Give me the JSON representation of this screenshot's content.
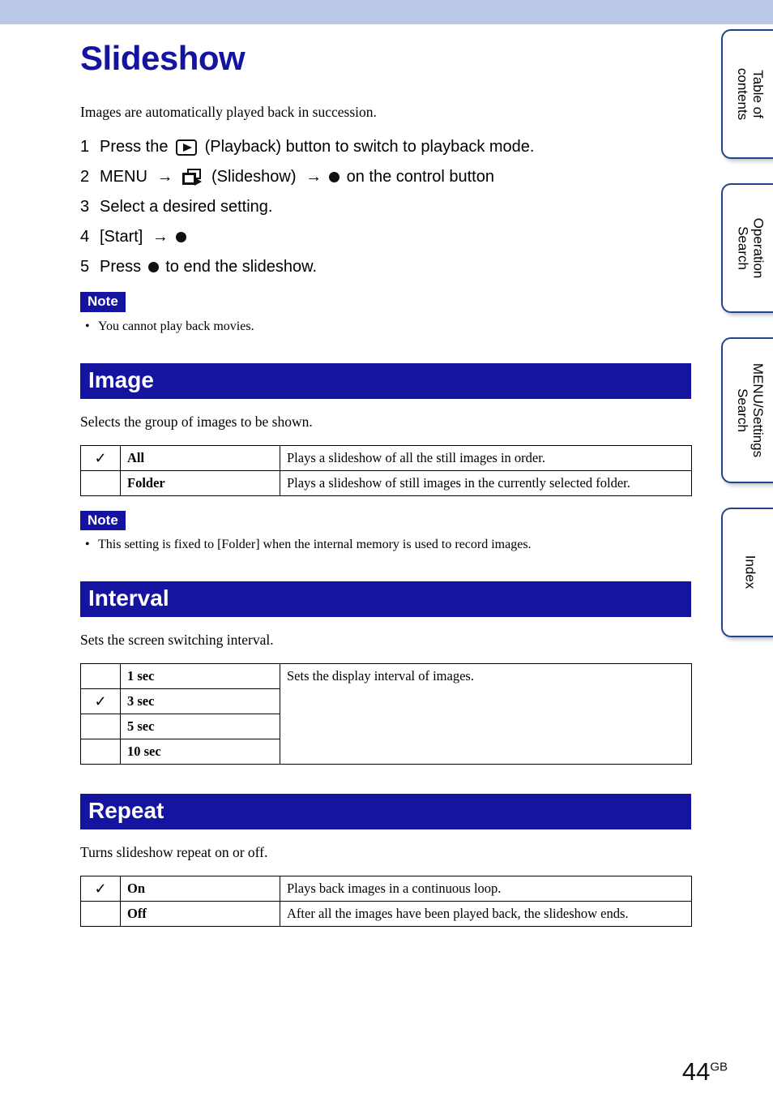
{
  "page": {
    "title": "Slideshow",
    "intro": "Images are automatically played back in succession.",
    "number": "44",
    "number_suffix": "GB",
    "banner_color": "#bcc8ea",
    "accent_color": "#1414a0"
  },
  "side_tabs": [
    {
      "label": "Table of\ncontents",
      "name": "table-of-contents"
    },
    {
      "label": "Operation\nSearch",
      "name": "operation-search"
    },
    {
      "label": "MENU/Settings\nSearch",
      "name": "menu-settings-search"
    },
    {
      "label": "Index",
      "name": "index"
    }
  ],
  "steps": [
    {
      "num": "1",
      "pre": "Press the ",
      "icon": "playback-button-icon",
      "post": " (Playback) button to switch to playback mode."
    },
    {
      "num": "2",
      "pre": "MENU ",
      "arrow1": "→",
      "icon": "slideshow-icon",
      "mid": " (Slideshow) ",
      "arrow2": "→",
      "dot": "control-button-center-dot",
      "post": " on the control button"
    },
    {
      "num": "3",
      "pre": "Select a desired setting."
    },
    {
      "num": "4",
      "pre": "[Start] ",
      "arrow1": "→",
      "dot": "control-button-center-dot"
    },
    {
      "num": "5",
      "pre": "Press ",
      "dot": "control-button-center-dot",
      "post": " to end the slideshow."
    }
  ],
  "note_top": {
    "badge": "Note",
    "items": [
      "You cannot play back movies."
    ]
  },
  "sections": [
    {
      "heading": "Image",
      "desc": "Selects the group of images to be shown.",
      "table": {
        "rows": [
          {
            "checked": true,
            "label": "All",
            "desc": "Plays a slideshow of all the still images in order."
          },
          {
            "checked": false,
            "label": "Folder",
            "desc": "Plays a slideshow of still images in the currently selected folder."
          }
        ]
      },
      "note": {
        "badge": "Note",
        "items": [
          "This setting is fixed to [Folder] when the internal memory is used to record images."
        ]
      }
    },
    {
      "heading": "Interval",
      "desc": "Sets the screen switching interval.",
      "table": {
        "shared_desc": "Sets the display interval of images.",
        "rows": [
          {
            "checked": false,
            "label": "1 sec"
          },
          {
            "checked": true,
            "label": "3 sec"
          },
          {
            "checked": false,
            "label": "5 sec"
          },
          {
            "checked": false,
            "label": "10 sec"
          }
        ]
      }
    },
    {
      "heading": "Repeat",
      "desc": "Turns slideshow repeat on or off.",
      "table": {
        "rows": [
          {
            "checked": true,
            "label": "On",
            "desc": "Plays back images in a continuous loop."
          },
          {
            "checked": false,
            "label": "Off",
            "desc": "After all the images have been played back, the slideshow ends."
          }
        ]
      }
    }
  ],
  "glyphs": {
    "check": "✓",
    "bullet": "•",
    "arrow": "→"
  }
}
